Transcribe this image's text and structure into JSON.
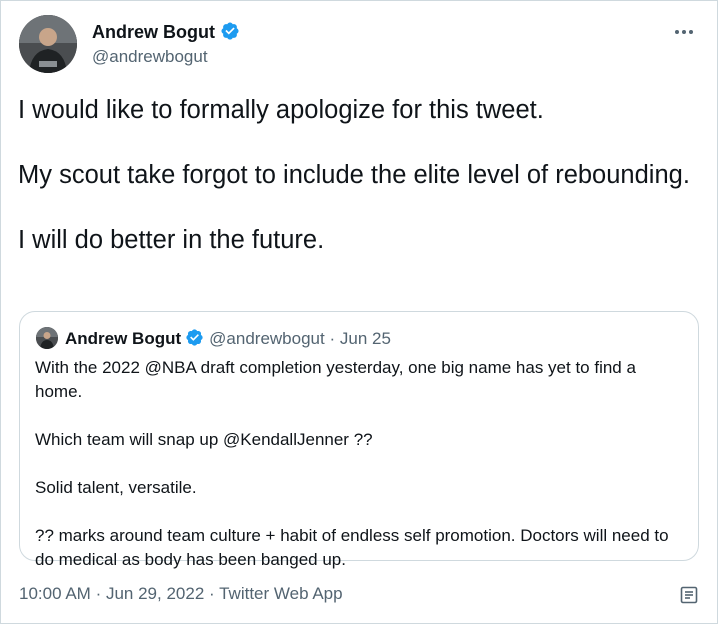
{
  "tweet": {
    "author_name": "Andrew Bogut",
    "author_handle": "@andrewbogut",
    "paragraphs": [
      "I would like to formally apologize for this tweet.",
      "My scout take forgot to include the elite level of rebounding.",
      "I will do better in the future."
    ],
    "time": "10:00 AM",
    "date": "Jun 29, 2022",
    "source": "Twitter Web App",
    "separator": "·"
  },
  "quote": {
    "author_name": "Andrew Bogut",
    "author_handle": "@andrewbogut",
    "separator": "·",
    "date": "Jun 25",
    "paragraphs": [
      "With the 2022 @NBA draft completion yesterday, one big name has yet to find a home.",
      "Which team will snap up @KendallJenner ??",
      "Solid talent, versatile.",
      "?? marks around team culture + habit of endless self promotion. Doctors will need to do medical as body has been banged up."
    ]
  },
  "icons": {
    "verified": "verified-badge-icon",
    "more": "more-options-icon",
    "analytics": "analytics-icon"
  },
  "colors": {
    "text": "#0f1419",
    "secondary": "#536471",
    "verified": "#1d9bf0",
    "border": "#cfd9de"
  }
}
